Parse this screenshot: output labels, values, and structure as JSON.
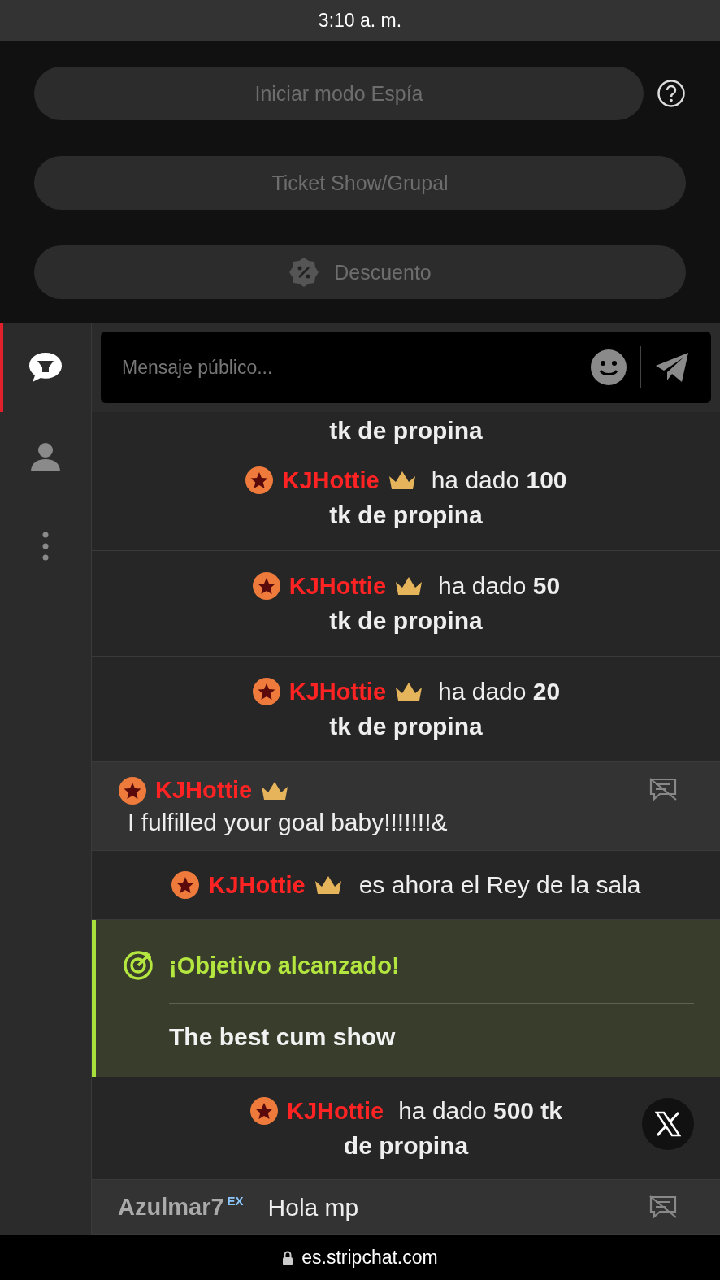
{
  "status_bar": {
    "time": "3:10 a. m."
  },
  "actions": [
    {
      "label": "Iniciar modo Espía",
      "help": true,
      "icon": false
    },
    {
      "label": "Ticket Show/Grupal",
      "help": false,
      "icon": false
    },
    {
      "label": "Descuento",
      "help": false,
      "icon": true
    }
  ],
  "sidebar": {
    "items": [
      {
        "kind": "chat",
        "selected": true
      },
      {
        "kind": "users",
        "selected": false
      },
      {
        "kind": "more",
        "selected": false
      }
    ]
  },
  "composer": {
    "placeholder": "Mensaje público..."
  },
  "messages": [
    {
      "kind": "fragment",
      "line2": "tk de propina"
    },
    {
      "kind": "tip",
      "user": "KJHottie",
      "star": true,
      "crown": true,
      "line1": "ha dado **100**",
      "line2": "tk de propina"
    },
    {
      "kind": "tip",
      "user": "KJHottie",
      "star": true,
      "crown": true,
      "line1": "ha dado **50**",
      "line2": "tk de propina"
    },
    {
      "kind": "tip",
      "user": "KJHottie",
      "star": true,
      "crown": true,
      "line1": "ha dado **20**",
      "line2": "tk de propina"
    },
    {
      "kind": "message",
      "user": "KJHottie",
      "star": true,
      "crown": true,
      "text": "I fulfilled your goal baby!!!!!!!&"
    },
    {
      "kind": "king",
      "user": "KJHottie",
      "star": true,
      "crown": true,
      "text": "es ahora el Rey de la sala"
    },
    {
      "kind": "goal",
      "title": "¡Objetivo alcanzado!",
      "text": "The best cum show"
    },
    {
      "kind": "tip",
      "user": "KJHottie",
      "star": true,
      "crown": false,
      "line1": "ha dado **500 tk**",
      "line2": "de propina"
    },
    {
      "kind": "message",
      "user": "Azulmar7",
      "star": false,
      "crown": false,
      "badge": "EX",
      "text": "Hola mp"
    }
  ],
  "url_bar": {
    "domain": "es.stripchat.com"
  }
}
